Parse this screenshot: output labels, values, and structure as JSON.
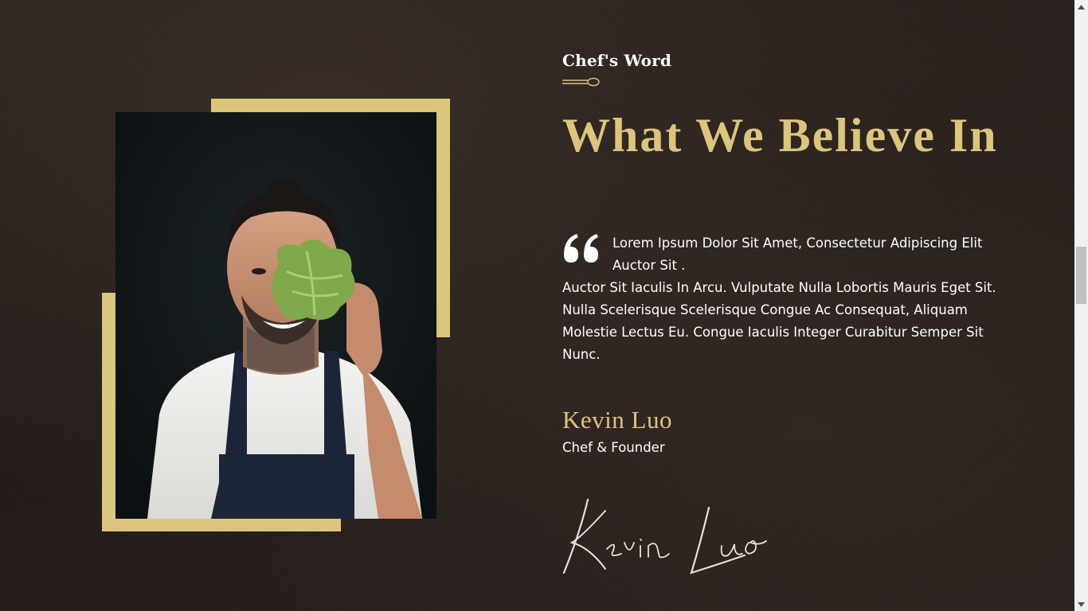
{
  "section": {
    "eyebrow": "Chef's Word",
    "headline": "What We Believe In",
    "quote_first_line": "Lorem Ipsum Dolor Sit Amet, Consectetur Adipiscing Elit Auctor Sit .",
    "quote_body": "Auctor Sit Iaculis In Arcu. Vulputate Nulla Lobortis Mauris Eget Sit. Nulla Scelerisque Scelerisque Congue Ac Consequat, Aliquam Molestie Lectus Eu. Congue Iaculis Integer Curabitur Semper Sit Nunc.",
    "chef_name": "Kevin Luo",
    "chef_role": "Chef & Founder",
    "signature": "Kevin Luo"
  },
  "icons": {
    "divider": "spoon-icon",
    "quote": "quote-icon",
    "photo": "chef-photo",
    "scroll_up": "chevron-up-icon",
    "scroll_down": "chevron-down-icon"
  },
  "colors": {
    "accent_gold": "#dcc57c",
    "background": "#1a1411",
    "text": "#ffffff"
  }
}
